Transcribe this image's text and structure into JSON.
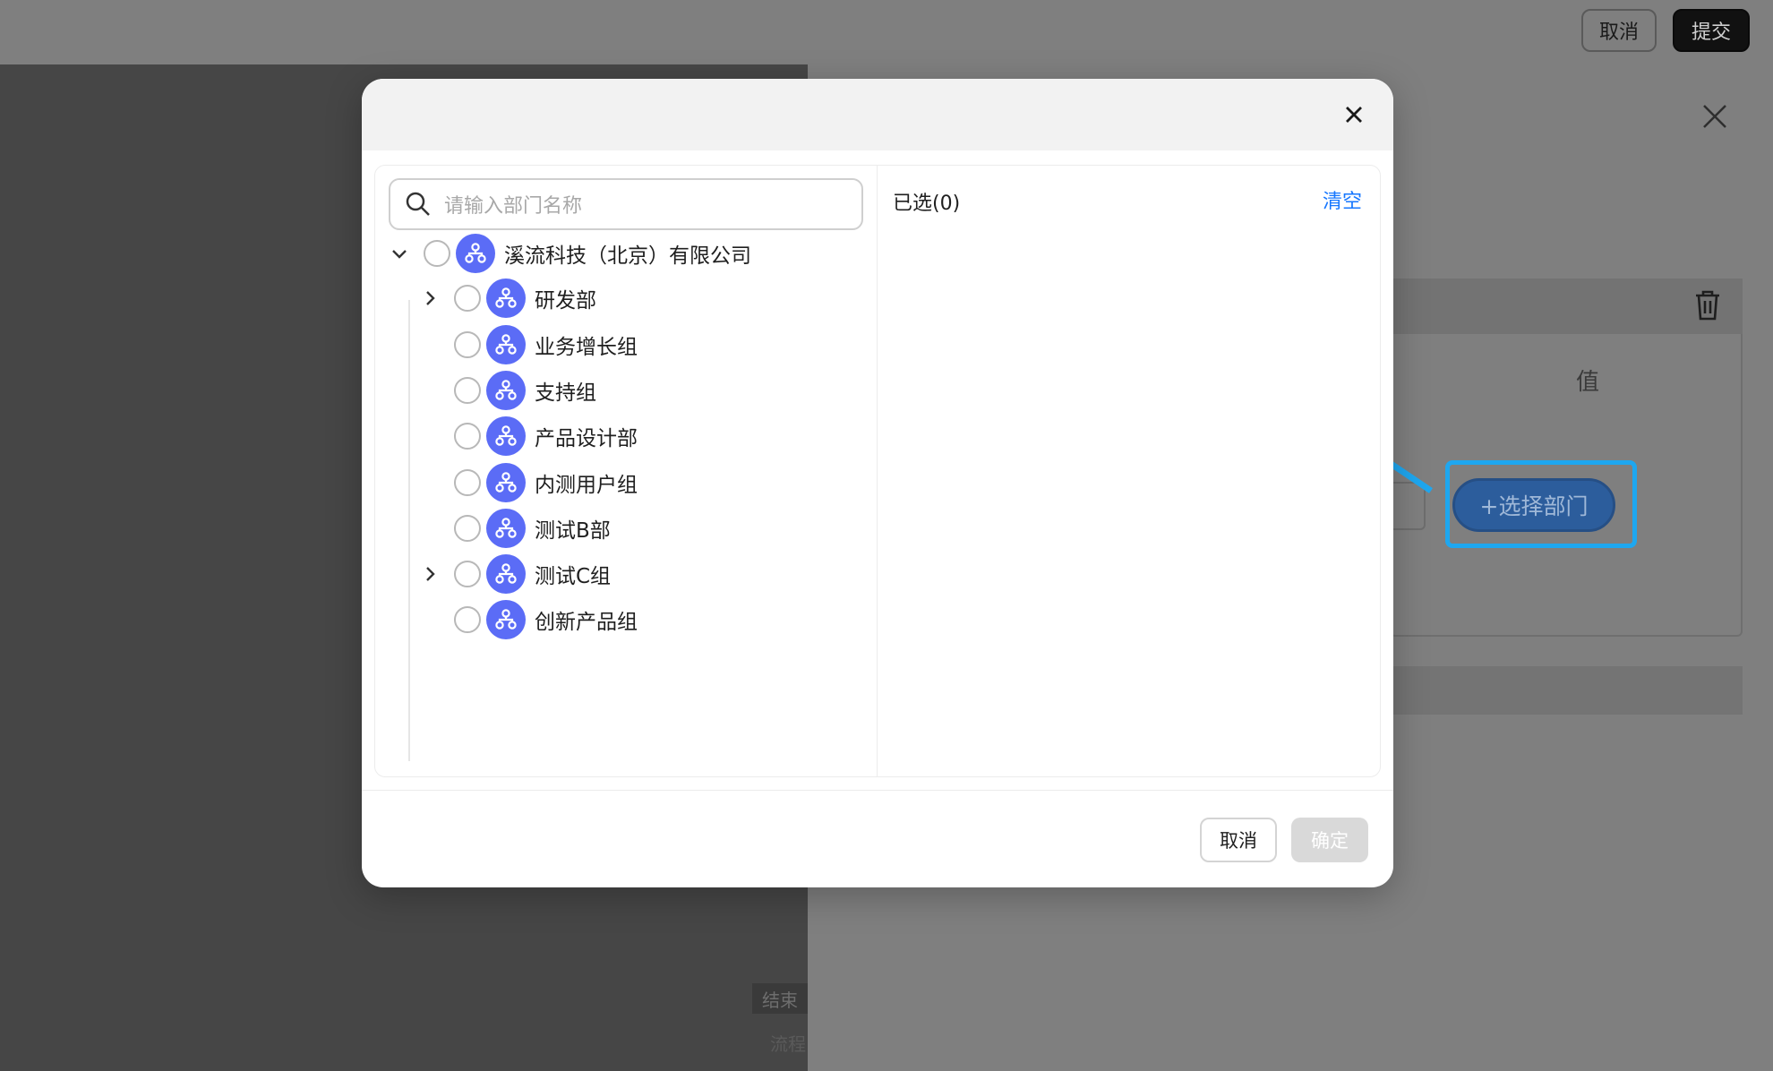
{
  "background": {
    "top_cancel_label": "取消",
    "top_submit_label": "提交",
    "value_label": "值",
    "select_dept_button": "+选择部门",
    "end_label": "结束",
    "flow_label": "流程"
  },
  "modal": {
    "search_placeholder": "请输入部门名称",
    "tree": [
      {
        "label": "溪流科技（北京）有限公司",
        "level": 0,
        "expandable": true,
        "expanded": true
      },
      {
        "label": "研发部",
        "level": 1,
        "expandable": true,
        "expanded": false
      },
      {
        "label": "业务增长组",
        "level": 1,
        "expandable": false
      },
      {
        "label": "支持组",
        "level": 1,
        "expandable": false
      },
      {
        "label": "产品设计部",
        "level": 1,
        "expandable": false
      },
      {
        "label": "内测用户组",
        "level": 1,
        "expandable": false
      },
      {
        "label": "测试B部",
        "level": 1,
        "expandable": false
      },
      {
        "label": "测试C组",
        "level": 1,
        "expandable": true,
        "expanded": false
      },
      {
        "label": "创新产品组",
        "level": 1,
        "expandable": false
      }
    ],
    "selected_title": "已选(0)",
    "clear_label": "清空",
    "cancel_label": "取消",
    "confirm_label": "确定"
  },
  "colors": {
    "accent": "#1677ff",
    "org_icon": "#5b6cf6",
    "highlight": "#1ea7f0"
  }
}
